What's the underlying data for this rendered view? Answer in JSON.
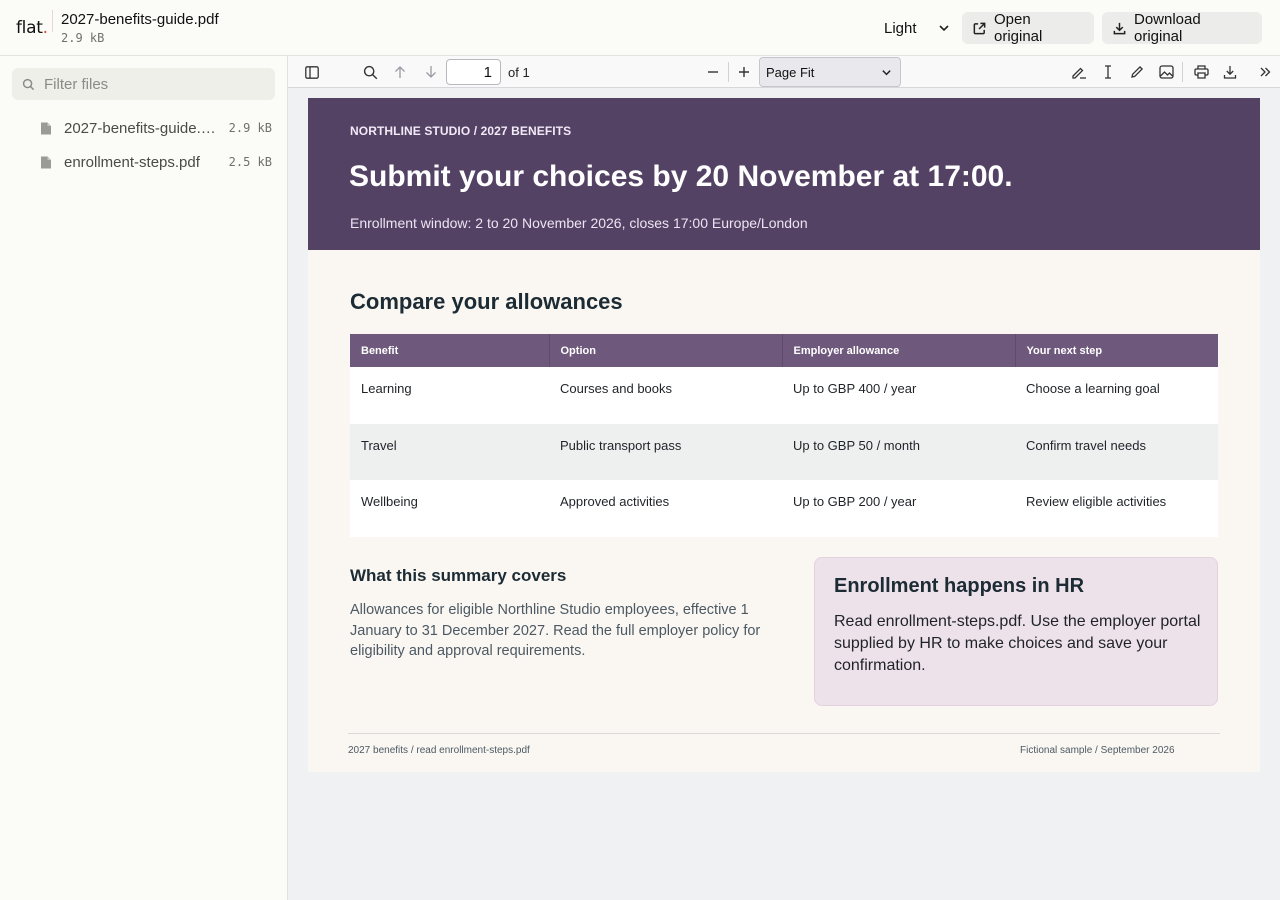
{
  "app": {
    "brand": "flat",
    "brand_dot": ".",
    "file_title": "2027-benefits-guide.pdf",
    "file_size": "2.9 kB",
    "theme": "Light",
    "open_original": "Open original",
    "download_original": "Download original"
  },
  "sidebar": {
    "filter_placeholder": "Filter files",
    "files": [
      {
        "name": "2027-benefits-guide.pdf",
        "size": "2.9 kB"
      },
      {
        "name": "enrollment-steps.pdf",
        "size": "2.5 kB"
      }
    ]
  },
  "viewer": {
    "page_number": "1",
    "page_count": "of 1",
    "zoom": "Page Fit"
  },
  "document": {
    "kicker": "NORTHLINE STUDIO / 2027 BENEFITS",
    "headline": "Submit your choices by 20 November at 17:00.",
    "window": "Enrollment window: 2 to 20 November 2026, closes 17:00 Europe/London",
    "section_title": "Compare your allowances",
    "table": {
      "headers": [
        "Benefit",
        "Option",
        "Employer allowance",
        "Your next step"
      ],
      "rows": [
        [
          "Learning",
          "Courses and books",
          "Up to GBP 400 / year",
          "Choose a learning goal"
        ],
        [
          "Travel",
          "Public transport pass",
          "Up to GBP 50 / month",
          "Confirm travel needs"
        ],
        [
          "Wellbeing",
          "Approved activities",
          "Up to GBP 200 / year",
          "Review eligible activities"
        ]
      ]
    },
    "covers_title": "What this summary covers",
    "covers_text": "Allowances for eligible Northline Studio employees, effective 1 January to 31 December 2027. Read the full employer policy for eligibility and approval requirements.",
    "hr_title": "Enrollment happens in HR",
    "hr_text": "Read enrollment-steps.pdf. Use the employer portal supplied by HR to make choices and save your confirmation.",
    "footer_left": "2027 benefits / read enrollment-steps.pdf",
    "footer_right": "Fictional sample / September 2026"
  },
  "colors": {
    "hero": "#544265",
    "table_header": "#6e587b",
    "card": "#ede1ea",
    "brand_dot": "#e0443c"
  }
}
